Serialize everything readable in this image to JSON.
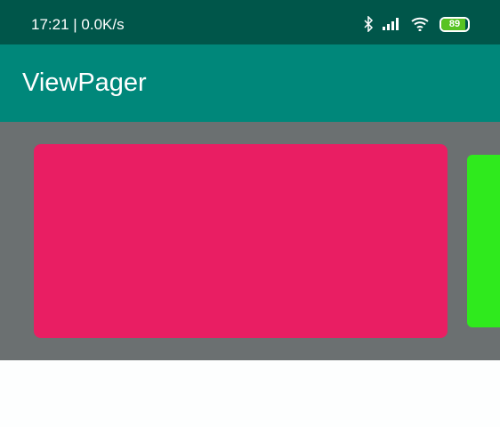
{
  "status": {
    "time": "17:21 | 0.0K/s",
    "battery": "89",
    "battery_level": 89,
    "icons": [
      "bluetooth-icon",
      "signal-icon",
      "wifi-icon",
      "battery-icon"
    ]
  },
  "appbar": {
    "title": "ViewPager"
  },
  "pager": {
    "pages": [
      {
        "color": "#e91e63"
      },
      {
        "color": "#2fea1d"
      }
    ]
  }
}
